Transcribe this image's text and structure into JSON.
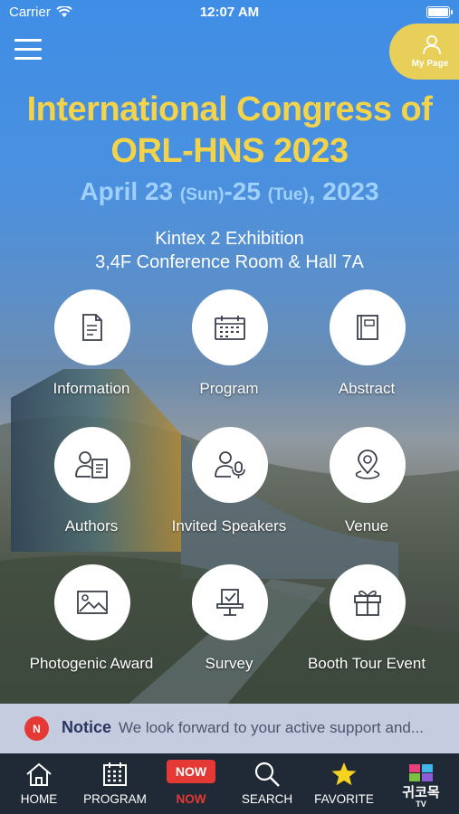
{
  "status_bar": {
    "carrier": "Carrier",
    "time": "12:07 AM"
  },
  "my_page": {
    "label": "My Page"
  },
  "header": {
    "title_line1": "International Congress of",
    "title_line2": "ORL-HNS 2023",
    "date_part1": "April 23 ",
    "date_day1": "(Sun)",
    "date_part2": "-25 ",
    "date_day2": "(Tue)",
    "date_part3": ", 2023",
    "venue_line1": "Kintex 2 Exhibition",
    "venue_line2": "3,4F Conference Room & Hall 7A"
  },
  "menu_grid": [
    {
      "label": "Information",
      "icon": "document-icon"
    },
    {
      "label": "Program",
      "icon": "calendar-icon"
    },
    {
      "label": "Abstract",
      "icon": "book-icon"
    },
    {
      "label": "Authors",
      "icon": "author-icon"
    },
    {
      "label": "Invited Speakers",
      "icon": "speaker-icon"
    },
    {
      "label": "Venue",
      "icon": "location-pin-icon"
    },
    {
      "label": "Photogenic Award",
      "icon": "picture-icon"
    },
    {
      "label": "Survey",
      "icon": "survey-icon"
    },
    {
      "label": "Booth Tour Event",
      "icon": "gift-icon"
    }
  ],
  "notice": {
    "badge": "N",
    "title": "Notice",
    "text": "We look forward to your active support and..."
  },
  "tab_bar": {
    "home": "HOME",
    "program": "PROGRAM",
    "now_badge": "NOW",
    "now": "NOW",
    "search": "SEARCH",
    "favorite": "FAVORITE",
    "tv_label": "귀코목",
    "tv_sub": "TV"
  },
  "colors": {
    "title": "#f2d34a",
    "date": "#9fd0ff",
    "my_page_bg": "#e8cf5a",
    "notice_badge": "#e53935",
    "tab_bar_bg": "#1f2a36",
    "favorite_star": "#f5d21f"
  }
}
